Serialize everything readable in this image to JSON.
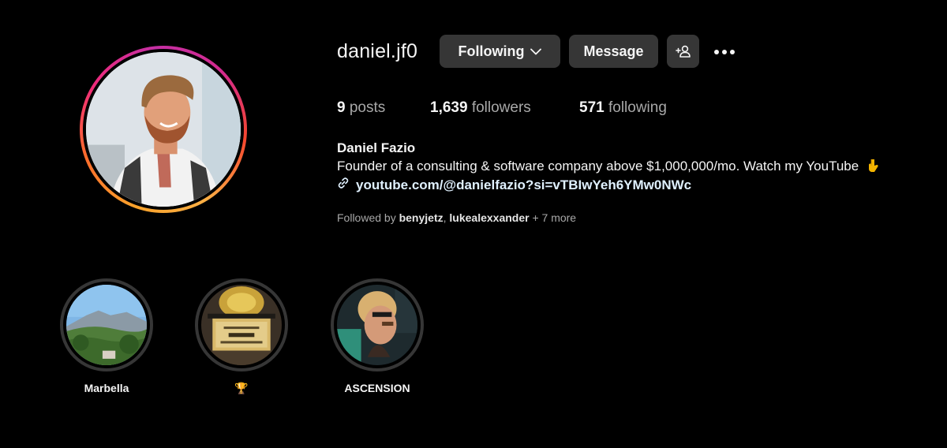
{
  "profile": {
    "username": "daniel.jf0",
    "full_name": "Daniel Fazio",
    "bio": "Founder of a consulting & software company above $1,000,000/mo. Watch my YouTube",
    "bio_emoji_icon": "pointing-down-hand-icon",
    "link": "youtube.com/@danielfazio?si=vTBIwYeh6YMw0NWc",
    "link_icon": "link-icon"
  },
  "actions": {
    "following_label": "Following",
    "message_label": "Message",
    "add_user_icon": "add-user-icon",
    "more_icon": "more-options-icon"
  },
  "stats": {
    "posts_count": "9",
    "posts_label": "posts",
    "followers_count": "1,639",
    "followers_label": "followers",
    "following_count": "571",
    "following_label": "following"
  },
  "followed_by": {
    "prefix": "Followed by",
    "user1": "benyjetz",
    "separator": ",",
    "user2": "lukealexxander",
    "more": "+ 7 more"
  },
  "highlights": [
    {
      "label": "Marbella"
    },
    {
      "label": "🏆"
    },
    {
      "label": "ASCENSION"
    }
  ],
  "colors": {
    "background": "#000000",
    "button_bg": "#363636",
    "text_primary": "#f5f5f5",
    "text_secondary": "#a8a8a8",
    "link_color": "#e0f1ff",
    "story_ring_start": "#fcaf45",
    "story_ring_end": "#c42fa3"
  }
}
